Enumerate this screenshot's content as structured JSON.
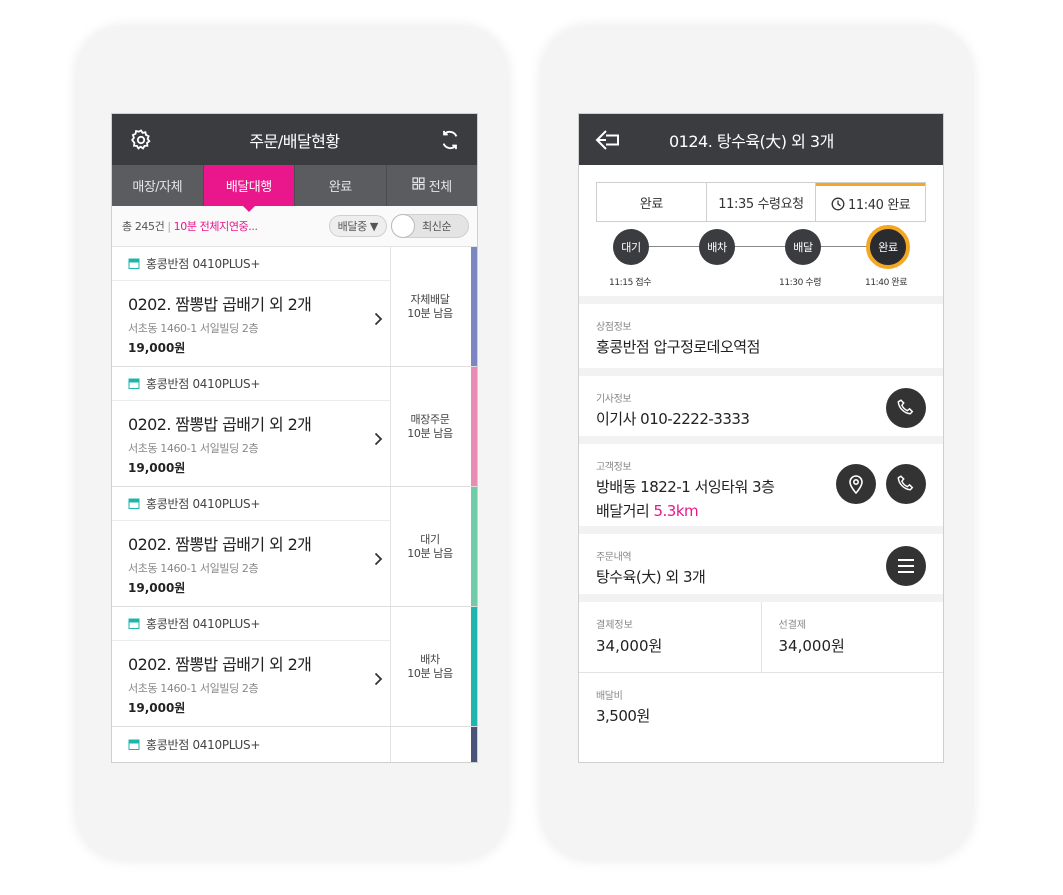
{
  "left": {
    "header": {
      "title": "주문/배달현황"
    },
    "tabs": [
      {
        "label": "매장/자체"
      },
      {
        "label": "배달대행"
      },
      {
        "label": "완료"
      },
      {
        "label": "전체"
      }
    ],
    "filter": {
      "count": "총 245건",
      "separator": "|",
      "notice": "10분 전체지연중...",
      "dropdown": "배달중 ▼",
      "sort": "최신순"
    },
    "orders": [
      {
        "store": "홍콩반점 0410PLUS+",
        "title": "0202. 짬뽕밥 곱배기 외 2개",
        "address": "서초동 1460-1 서일빌딩 2층",
        "price": "19,000원",
        "status1": "자체배달",
        "status2": "10분 남음",
        "color": "#7b86c2"
      },
      {
        "store": "홍콩반점 0410PLUS+",
        "title": "0202. 짬뽕밥 곱배기 외 2개",
        "address": "서초동 1460-1 서일빌딩 2층",
        "price": "19,000원",
        "status1": "매장주문",
        "status2": "10분 남음",
        "color": "#e98cb3"
      },
      {
        "store": "홍콩반점 0410PLUS+",
        "title": "0202. 짬뽕밥 곱배기 외 2개",
        "address": "서초동 1460-1 서일빌딩 2층",
        "price": "19,000원",
        "status1": "대기",
        "status2": "10분 남음",
        "color": "#6fcba8"
      },
      {
        "store": "홍콩반점 0410PLUS+",
        "title": "0202. 짬뽕밥 곱배기 외 2개",
        "address": "서초동 1460-1 서일빌딩 2층",
        "price": "19,000원",
        "status1": "배차",
        "status2": "10분 남음",
        "color": "#1fb5ac"
      },
      {
        "store": "홍콩반점 0410PLUS+",
        "color": "#4a5478"
      }
    ]
  },
  "right": {
    "header": {
      "title": "0124. 탕수육(大) 외 3개"
    },
    "buttons": {
      "complete": "완료",
      "pickup_request": "11:35 수령요청",
      "complete_time": "11:40 완료"
    },
    "timeline": {
      "nodes": [
        "대기",
        "배차",
        "배달",
        "완료"
      ],
      "labels": {
        "wait": "11:15 접수",
        "deliver": "11:30 수령",
        "done": "11:40 완료"
      }
    },
    "store": {
      "label": "상점정보",
      "value": "홍콩반점 압구정로데오역점"
    },
    "driver": {
      "label": "기사정보",
      "value": "이기사 010-2222-3333"
    },
    "customer": {
      "label": "고객정보",
      "address": "방배동 1822-1 서잉타워 3층",
      "distance_label": "배달거리",
      "distance": "5.3km"
    },
    "order_detail": {
      "label": "주문내역",
      "value": "탕수육(大) 외 3개"
    },
    "payment": {
      "label": "결제정보",
      "value": "34,000원",
      "prepaid_label": "선결제",
      "prepaid_value": "34,000원"
    },
    "fee": {
      "label": "배달비",
      "value": "3,500원"
    }
  },
  "colors": {
    "accent": "#ea168b",
    "header": "#3a3c40",
    "highlight": "#f5a623"
  }
}
